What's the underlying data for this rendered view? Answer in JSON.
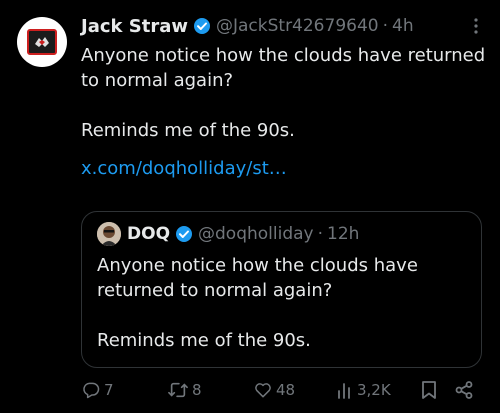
{
  "tweet": {
    "display_name": "Jack Straw",
    "handle": "@JackStr42679640",
    "separator": "·",
    "time": "4h",
    "text": "Anyone notice how the clouds have returned to normal again?\n\nReminds me of the 90s.",
    "link_text": "x.com/doqholliday/st…"
  },
  "quoted_tweet": {
    "display_name": "DOQ",
    "handle": "@doqholliday",
    "separator": "·",
    "time": "12h",
    "text": "Anyone notice how the clouds have returned to normal again?\n\nReminds me of the 90s."
  },
  "actions": {
    "replies": "7",
    "reposts": "8",
    "likes": "48",
    "views": "3,2K"
  },
  "icons": [
    "verified-badge-icon",
    "more-icon",
    "reply-icon",
    "repost-icon",
    "like-icon",
    "views-icon",
    "bookmark-icon",
    "share-icon"
  ],
  "colors": {
    "background": "#000000",
    "text": "#e7e9ea",
    "muted": "#71767b",
    "link": "#1d9bf0",
    "verified": "#1d9bf0",
    "border": "#2f3336"
  }
}
